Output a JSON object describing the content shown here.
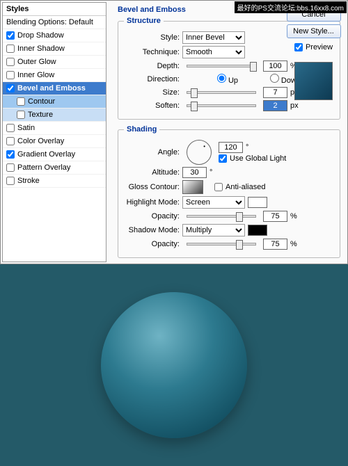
{
  "watermark": "最好的PS交流论坛:bbs.16xx8.com",
  "styles": {
    "header": "Styles",
    "blending": "Blending Options: Default",
    "items": [
      {
        "label": "Drop Shadow",
        "checked": true
      },
      {
        "label": "Inner Shadow",
        "checked": false
      },
      {
        "label": "Outer Glow",
        "checked": false
      },
      {
        "label": "Inner Glow",
        "checked": false
      },
      {
        "label": "Bevel and Emboss",
        "checked": true,
        "active": true
      },
      {
        "label": "Contour",
        "checked": false,
        "sub": true
      },
      {
        "label": "Texture",
        "checked": false,
        "sub": true
      },
      {
        "label": "Satin",
        "checked": false
      },
      {
        "label": "Color Overlay",
        "checked": false
      },
      {
        "label": "Gradient Overlay",
        "checked": true
      },
      {
        "label": "Pattern Overlay",
        "checked": false
      },
      {
        "label": "Stroke",
        "checked": false
      }
    ]
  },
  "main": {
    "title": "Bevel and Emboss",
    "structure": {
      "legend": "Structure",
      "style_label": "Style:",
      "style_value": "Inner Bevel",
      "technique_label": "Technique:",
      "technique_value": "Smooth",
      "depth_label": "Depth:",
      "depth_value": "100",
      "depth_unit": "%",
      "direction_label": "Direction:",
      "dir_up": "Up",
      "dir_down": "Down",
      "size_label": "Size:",
      "size_value": "7",
      "size_unit": "px",
      "soften_label": "Soften:",
      "soften_value": "2",
      "soften_unit": "px"
    },
    "shading": {
      "legend": "Shading",
      "angle_label": "Angle:",
      "angle_value": "120",
      "angle_unit": "°",
      "global_light": "Use Global Light",
      "altitude_label": "Altitude:",
      "altitude_value": "30",
      "altitude_unit": "°",
      "gloss_label": "Gloss Contour:",
      "antialiased": "Anti-aliased",
      "highlight_label": "Highlight Mode:",
      "highlight_value": "Screen",
      "highlight_color": "#ffffff",
      "opacity_label": "Opacity:",
      "opacity1_value": "75",
      "opacity_unit": "%",
      "shadow_label": "Shadow Mode:",
      "shadow_value": "Multiply",
      "shadow_color": "#000000",
      "opacity2_value": "75"
    }
  },
  "buttons": {
    "cancel": "Cancel",
    "new_style": "New Style...",
    "preview": "Preview"
  }
}
